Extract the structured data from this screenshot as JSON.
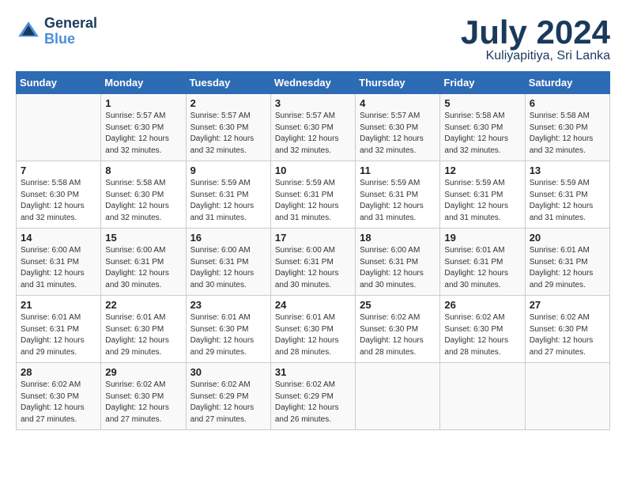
{
  "header": {
    "logo_line1": "General",
    "logo_line2": "Blue",
    "title": "July 2024",
    "location": "Kuliyapitiya, Sri Lanka"
  },
  "days_of_week": [
    "Sunday",
    "Monday",
    "Tuesday",
    "Wednesday",
    "Thursday",
    "Friday",
    "Saturday"
  ],
  "weeks": [
    [
      {
        "day": "",
        "info": ""
      },
      {
        "day": "1",
        "info": "Sunrise: 5:57 AM\nSunset: 6:30 PM\nDaylight: 12 hours\nand 32 minutes."
      },
      {
        "day": "2",
        "info": "Sunrise: 5:57 AM\nSunset: 6:30 PM\nDaylight: 12 hours\nand 32 minutes."
      },
      {
        "day": "3",
        "info": "Sunrise: 5:57 AM\nSunset: 6:30 PM\nDaylight: 12 hours\nand 32 minutes."
      },
      {
        "day": "4",
        "info": "Sunrise: 5:57 AM\nSunset: 6:30 PM\nDaylight: 12 hours\nand 32 minutes."
      },
      {
        "day": "5",
        "info": "Sunrise: 5:58 AM\nSunset: 6:30 PM\nDaylight: 12 hours\nand 32 minutes."
      },
      {
        "day": "6",
        "info": "Sunrise: 5:58 AM\nSunset: 6:30 PM\nDaylight: 12 hours\nand 32 minutes."
      }
    ],
    [
      {
        "day": "7",
        "info": "Sunrise: 5:58 AM\nSunset: 6:30 PM\nDaylight: 12 hours\nand 32 minutes."
      },
      {
        "day": "8",
        "info": "Sunrise: 5:58 AM\nSunset: 6:30 PM\nDaylight: 12 hours\nand 32 minutes."
      },
      {
        "day": "9",
        "info": "Sunrise: 5:59 AM\nSunset: 6:31 PM\nDaylight: 12 hours\nand 31 minutes."
      },
      {
        "day": "10",
        "info": "Sunrise: 5:59 AM\nSunset: 6:31 PM\nDaylight: 12 hours\nand 31 minutes."
      },
      {
        "day": "11",
        "info": "Sunrise: 5:59 AM\nSunset: 6:31 PM\nDaylight: 12 hours\nand 31 minutes."
      },
      {
        "day": "12",
        "info": "Sunrise: 5:59 AM\nSunset: 6:31 PM\nDaylight: 12 hours\nand 31 minutes."
      },
      {
        "day": "13",
        "info": "Sunrise: 5:59 AM\nSunset: 6:31 PM\nDaylight: 12 hours\nand 31 minutes."
      }
    ],
    [
      {
        "day": "14",
        "info": "Sunrise: 6:00 AM\nSunset: 6:31 PM\nDaylight: 12 hours\nand 31 minutes."
      },
      {
        "day": "15",
        "info": "Sunrise: 6:00 AM\nSunset: 6:31 PM\nDaylight: 12 hours\nand 30 minutes."
      },
      {
        "day": "16",
        "info": "Sunrise: 6:00 AM\nSunset: 6:31 PM\nDaylight: 12 hours\nand 30 minutes."
      },
      {
        "day": "17",
        "info": "Sunrise: 6:00 AM\nSunset: 6:31 PM\nDaylight: 12 hours\nand 30 minutes."
      },
      {
        "day": "18",
        "info": "Sunrise: 6:00 AM\nSunset: 6:31 PM\nDaylight: 12 hours\nand 30 minutes."
      },
      {
        "day": "19",
        "info": "Sunrise: 6:01 AM\nSunset: 6:31 PM\nDaylight: 12 hours\nand 30 minutes."
      },
      {
        "day": "20",
        "info": "Sunrise: 6:01 AM\nSunset: 6:31 PM\nDaylight: 12 hours\nand 29 minutes."
      }
    ],
    [
      {
        "day": "21",
        "info": "Sunrise: 6:01 AM\nSunset: 6:31 PM\nDaylight: 12 hours\nand 29 minutes."
      },
      {
        "day": "22",
        "info": "Sunrise: 6:01 AM\nSunset: 6:30 PM\nDaylight: 12 hours\nand 29 minutes."
      },
      {
        "day": "23",
        "info": "Sunrise: 6:01 AM\nSunset: 6:30 PM\nDaylight: 12 hours\nand 29 minutes."
      },
      {
        "day": "24",
        "info": "Sunrise: 6:01 AM\nSunset: 6:30 PM\nDaylight: 12 hours\nand 28 minutes."
      },
      {
        "day": "25",
        "info": "Sunrise: 6:02 AM\nSunset: 6:30 PM\nDaylight: 12 hours\nand 28 minutes."
      },
      {
        "day": "26",
        "info": "Sunrise: 6:02 AM\nSunset: 6:30 PM\nDaylight: 12 hours\nand 28 minutes."
      },
      {
        "day": "27",
        "info": "Sunrise: 6:02 AM\nSunset: 6:30 PM\nDaylight: 12 hours\nand 27 minutes."
      }
    ],
    [
      {
        "day": "28",
        "info": "Sunrise: 6:02 AM\nSunset: 6:30 PM\nDaylight: 12 hours\nand 27 minutes."
      },
      {
        "day": "29",
        "info": "Sunrise: 6:02 AM\nSunset: 6:30 PM\nDaylight: 12 hours\nand 27 minutes."
      },
      {
        "day": "30",
        "info": "Sunrise: 6:02 AM\nSunset: 6:29 PM\nDaylight: 12 hours\nand 27 minutes."
      },
      {
        "day": "31",
        "info": "Sunrise: 6:02 AM\nSunset: 6:29 PM\nDaylight: 12 hours\nand 26 minutes."
      },
      {
        "day": "",
        "info": ""
      },
      {
        "day": "",
        "info": ""
      },
      {
        "day": "",
        "info": ""
      }
    ]
  ]
}
